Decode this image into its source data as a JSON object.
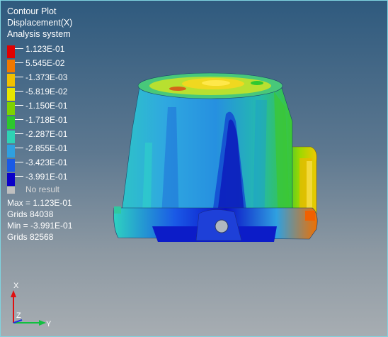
{
  "header": {
    "title": "Contour Plot",
    "result_type": "Displacement(X)",
    "system": "Analysis system"
  },
  "legend": [
    {
      "label": "1.123E-01",
      "color": "#e00000"
    },
    {
      "label": "5.545E-02",
      "color": "#f07800"
    },
    {
      "label": "-1.373E-03",
      "color": "#f0c000"
    },
    {
      "label": "-5.819E-02",
      "color": "#e6e600"
    },
    {
      "label": "-1.150E-01",
      "color": "#7ed200"
    },
    {
      "label": "-1.718E-01",
      "color": "#2dc82d"
    },
    {
      "label": "-2.287E-01",
      "color": "#2ed2b4"
    },
    {
      "label": "-2.855E-01",
      "color": "#2fa0e0"
    },
    {
      "label": "-3.423E-01",
      "color": "#1a5ae6"
    },
    {
      "label": "-3.991E-01",
      "color": "#0a00c8"
    }
  ],
  "no_result": {
    "label": "No result",
    "color": "#bfbfbf"
  },
  "stats": {
    "max": "Max = 1.123E-01",
    "max_grid": "Grids 84038",
    "min": "Min = -3.991E-01",
    "min_grid": "Grids 82568"
  },
  "triad": {
    "x": "X",
    "y": "Y",
    "z": "Z"
  }
}
